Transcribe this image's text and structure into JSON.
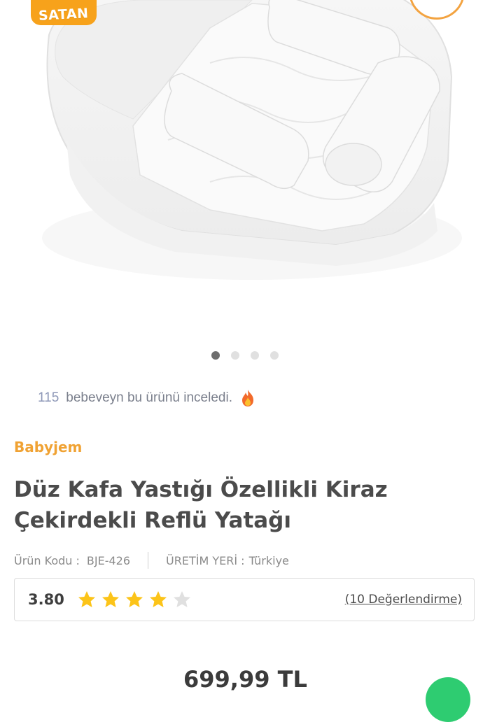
{
  "gallery": {
    "badge_text": "SATAN",
    "image_count": 4,
    "active_index": 0
  },
  "views": {
    "count": "115",
    "text": "bebeveyn bu ürünü inceledi.",
    "icon": "fire-icon"
  },
  "product": {
    "brand": "Babyjem",
    "title": "Düz Kafa Yastığı Özellikli Kiraz Çekirdekli Reflü Yatağı",
    "code_label": "Ürün Kodu :",
    "code_value": "BJE-426",
    "origin_label": "ÜRETİM YERİ :",
    "origin_value": "Türkiye"
  },
  "rating": {
    "value": "3.80",
    "stars_filled": 4,
    "stars_total": 5,
    "reviews_text": "(10 Değerlendirme)"
  },
  "price": {
    "text": "699,99 TL"
  },
  "colors": {
    "brand": "#f0a233",
    "badge": "#f7a21b",
    "star": "#fcc419",
    "star_empty": "#e0e0e0"
  }
}
